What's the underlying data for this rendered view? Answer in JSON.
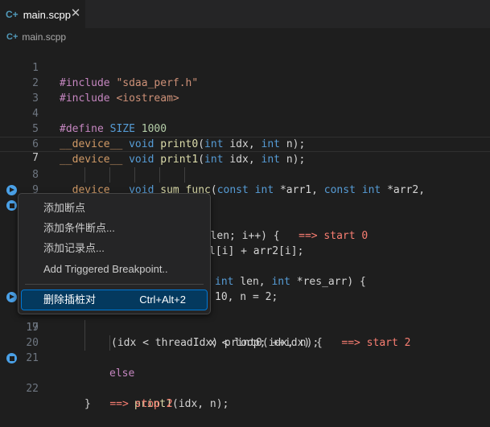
{
  "tab": {
    "title": "main.scpp",
    "icon": "c-plus-plus-icon",
    "close": "✕"
  },
  "breadcrumb": {
    "file": "main.scpp"
  },
  "colors": {
    "background": "#1e1e1e",
    "keyword": "#569cd6",
    "function": "#dcdcaa",
    "string": "#ce9178",
    "number": "#b5cea8",
    "breakpoint": "#4aa0e6",
    "annotation": "#f97e72",
    "menu_selection": "#04395e"
  },
  "editor": {
    "line_numbers": [
      "1",
      "2",
      "3",
      "4",
      "5",
      "6",
      "7",
      "8",
      "9",
      "10",
      "11",
      "12",
      "13",
      "14",
      "15",
      "16",
      "17",
      "18",
      "19",
      "20",
      "21",
      "22"
    ],
    "current_line": "7",
    "breakpoint_lines": [
      {
        "line": "10",
        "kind": "play"
      },
      {
        "line": "11",
        "kind": "stop"
      },
      {
        "line": "17",
        "kind": "play"
      },
      {
        "line": "21",
        "kind": "stop"
      }
    ],
    "code": {
      "l1": {
        "directive": "#include",
        "value": "\"sdaa_perf.h\""
      },
      "l2": {
        "directive": "#include",
        "value": "<iostream>"
      },
      "l4": {
        "directive": "#define",
        "name": "SIZE",
        "value": "1000"
      },
      "l5": {
        "qual": "__device__",
        "type": "void",
        "fn": "print0",
        "open": "(",
        "t1": "int",
        "p1": "idx",
        "sep": ",",
        "t2": "int",
        "p2": "n",
        "close": ");"
      },
      "l6": {
        "qual": "__device__",
        "type": "void",
        "fn": "print1",
        "open": "(",
        "t1": "int",
        "p1": "idx",
        "sep": ",",
        "t2": "int",
        "p2": "n",
        "close": ");"
      },
      "l8": {
        "qual": "__device__",
        "type": "void",
        "fn": "sum_func",
        "open": "(",
        "c1": "const",
        "t1": "int",
        "p1": "*arr1",
        "sep": ",",
        "c2": "const",
        "t2": "int",
        "p2": "*arr2",
        "end": ","
      },
      "l9": {
        "t1": "int",
        "p1": "len",
        "sep": ",",
        "t2": "int",
        "p2": "*res_arr",
        "end": ") {"
      },
      "l10": {
        "kw": "for",
        "text": " (int i = 0; i < len; i++) {",
        "ann": "==> start 0"
      },
      "l11": {
        "text": "l[i] + arr2[i];"
      },
      "l17": {
        "text": "10, n = 2;"
      },
      "l18": {
        "text": "x < loop; ++idx) {",
        "ann": "==> start 2"
      },
      "l19": {
        "text": "(idx < threadIdx) print0(idx, n);"
      },
      "l20": {
        "kw": "else"
      },
      "l21": {
        "fn": "print1",
        "text": "(idx, n);"
      },
      "l22": {
        "brace": "}",
        "ann": "==> stop 2"
      }
    }
  },
  "context_menu": {
    "items": [
      {
        "label": "添加断点"
      },
      {
        "label": "添加条件断点..."
      },
      {
        "label": "添加记录点..."
      },
      {
        "label": "Add Triggered Breakpoint.."
      },
      {
        "label": "删除插桩对",
        "shortcut": "Ctrl+Alt+2"
      }
    ]
  }
}
